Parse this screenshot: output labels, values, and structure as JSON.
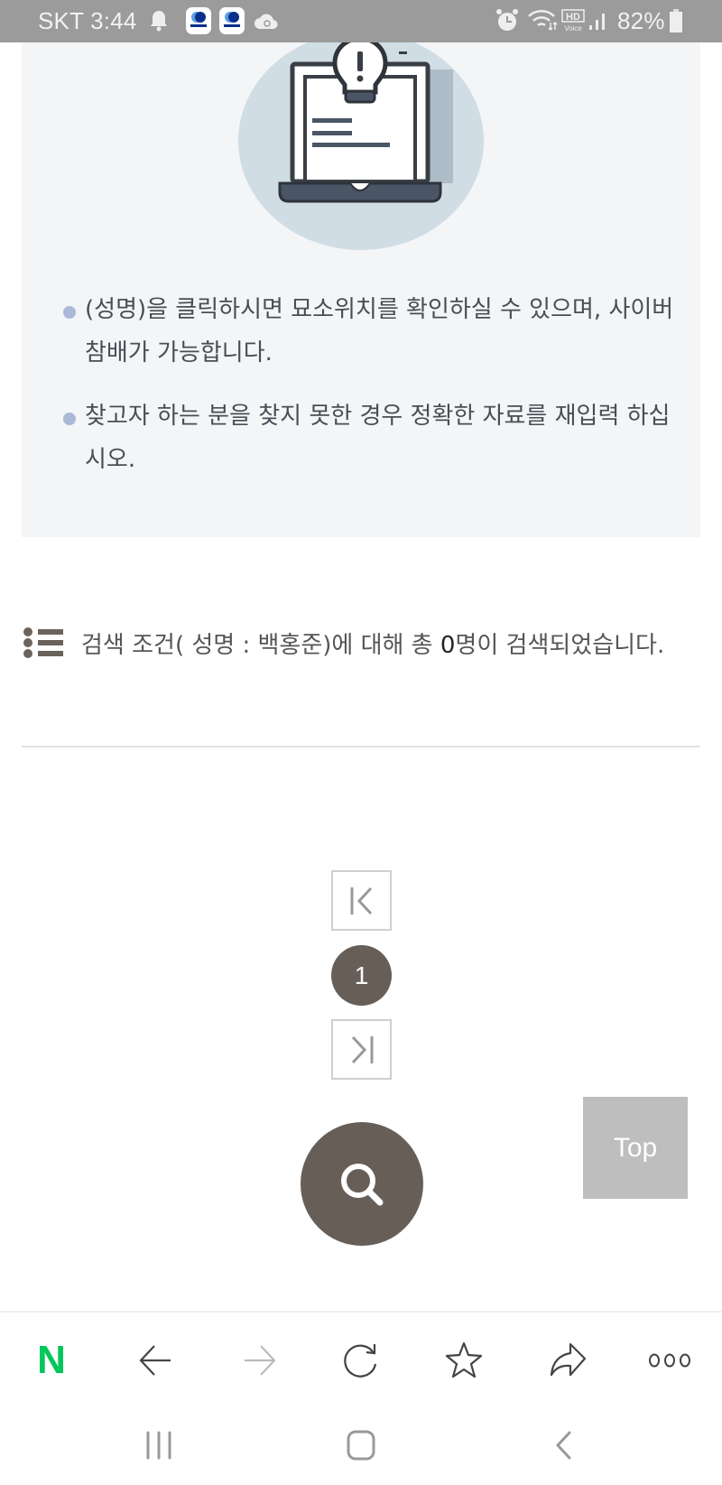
{
  "status_bar": {
    "carrier_time": "SKT 3:44",
    "battery_percent": "82%",
    "left_icons": [
      "bell-icon",
      "won-app-icon",
      "won-app-icon",
      "cloud-sync-icon"
    ],
    "right_icons": [
      "alarm-icon",
      "wifi-icon",
      "hd-voice-icon",
      "signal-icon",
      "battery-icon"
    ],
    "hd_label": "HD",
    "voice_label": "Voice"
  },
  "info": {
    "illustration": "laptop-lightbulb-icon",
    "bullets": [
      "(성명)을 클릭하시면 묘소위치를 확인하실 수 있으며, 사이버참배가 가능합니다.",
      "찾고자 하는 분을 찾지 못한 경우 정확한 자료를 재입력 하십시오."
    ]
  },
  "result": {
    "prefix": "검색 조건( 성명 : 백홍준)에 대해 총 ",
    "count": "0",
    "suffix": "명이 검색되었습니다."
  },
  "pagination": {
    "first_label": "first-page",
    "current_page": "1",
    "last_label": "last-page"
  },
  "buttons": {
    "search": "search",
    "top": "Top"
  },
  "browser_bar": {
    "home_logo": "N",
    "items": [
      "naver-home",
      "back",
      "forward",
      "reload",
      "bookmark",
      "share",
      "more"
    ]
  },
  "nav_bar": {
    "items": [
      "recent-apps",
      "home",
      "back"
    ]
  },
  "colors": {
    "brand_green": "#03c75a",
    "accent_brown": "#675e58",
    "panel_bg": "#f4f5f7",
    "bullet_dot": "#aab9d8"
  }
}
